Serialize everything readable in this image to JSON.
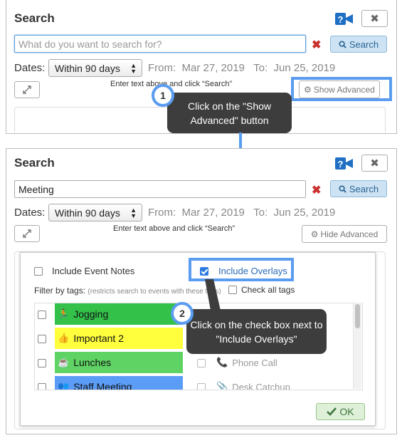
{
  "panel1": {
    "title": "Search",
    "search_placeholder": "What do you want to search for?",
    "search_value": "",
    "clear_glyph": "✖",
    "search_button": "Search",
    "dates_label": "Dates:",
    "date_range_option": "Within 90 days",
    "from_label": "From:",
    "from_date": "Mar 27, 2019",
    "to_label": "To:",
    "to_date": "Jun 25, 2019",
    "hint": "Enter text above and click “Search”",
    "advanced_button": "Show Advanced"
  },
  "callout1": {
    "number": "1",
    "text": "Click on the \"Show Advanced\" button"
  },
  "panel2": {
    "title": "Search",
    "search_value": "Meeting",
    "clear_glyph": "✖",
    "search_button": "Search",
    "dates_label": "Dates:",
    "date_range_option": "Within 90 days",
    "from_label": "From:",
    "from_date": "Mar 27, 2019",
    "to_label": "To:",
    "to_date": "Jun 25, 2019",
    "hint": "Enter text above and click “Search”",
    "advanced_button": "Hide Advanced"
  },
  "advanced": {
    "include_event_notes": {
      "label": "Include Event Notes",
      "checked": false
    },
    "include_overlays": {
      "label": "Include Overlays",
      "checked": true
    },
    "filter_label": "Filter by tags:",
    "filter_note": "(restricts search to events with these tags)",
    "check_all_tags": "Check all tags",
    "tags_left": [
      {
        "label": "Jogging",
        "color": "#33c14a",
        "icon": "running-icon"
      },
      {
        "label": "Important 2",
        "color": "#ffff3d",
        "icon": "thumbs-up-icon"
      },
      {
        "label": "Lunches",
        "color": "#5fd364",
        "icon": "coffee-icon"
      },
      {
        "label": "Staff Meeting",
        "color": "#5b9cf7",
        "icon": "users-icon"
      }
    ],
    "tags_right": [
      {
        "label": "Phone Call",
        "icon": "phone-icon"
      },
      {
        "label": "Desk Catchup",
        "icon": "paperclip-icon"
      }
    ],
    "ok_button": "OK"
  },
  "callout2": {
    "number": "2",
    "text": "Click on the check box next to \"Include Overlays\""
  },
  "colors": {
    "accent_blue": "#5a9cf0",
    "callout_bg": "#3d3d3d",
    "search_btn_bg": "#cde3f3",
    "ok_bg": "#dff0d8"
  }
}
